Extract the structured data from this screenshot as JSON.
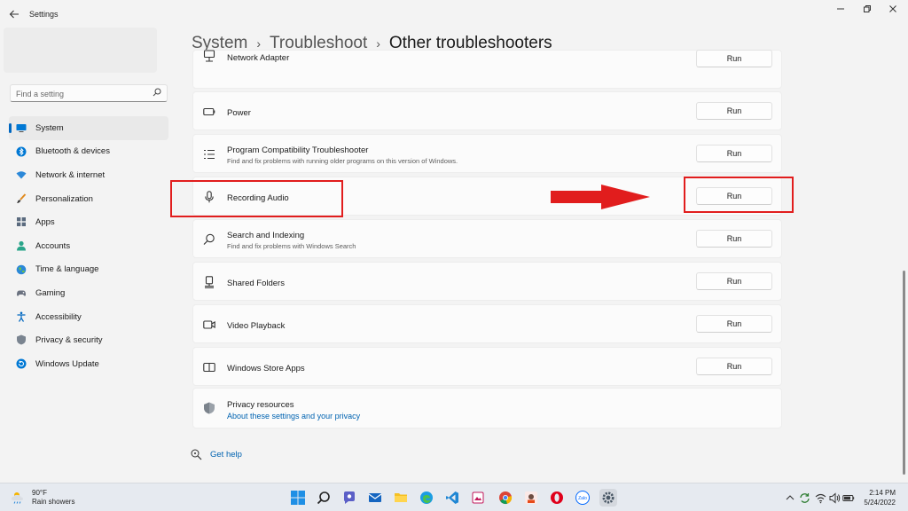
{
  "window": {
    "app_title": "Settings"
  },
  "sidebar": {
    "search_placeholder": "Find a setting",
    "items": [
      {
        "label": "System",
        "icon": "system-icon"
      },
      {
        "label": "Bluetooth & devices",
        "icon": "bluetooth-icon"
      },
      {
        "label": "Network & internet",
        "icon": "wifi-icon"
      },
      {
        "label": "Personalization",
        "icon": "brush-icon"
      },
      {
        "label": "Apps",
        "icon": "apps-icon"
      },
      {
        "label": "Accounts",
        "icon": "account-icon"
      },
      {
        "label": "Time & language",
        "icon": "globe-icon"
      },
      {
        "label": "Gaming",
        "icon": "gamepad-icon"
      },
      {
        "label": "Accessibility",
        "icon": "accessibility-icon"
      },
      {
        "label": "Privacy & security",
        "icon": "shield-icon"
      },
      {
        "label": "Windows Update",
        "icon": "update-icon"
      }
    ]
  },
  "breadcrumb": {
    "items": [
      "System",
      "Troubleshoot"
    ],
    "current": "Other troubleshooters"
  },
  "troubleshooters": [
    {
      "title": "Network Adapter",
      "desc": "",
      "button": "Run",
      "icon": "network-adapter-icon"
    },
    {
      "title": "Power",
      "desc": "",
      "button": "Run",
      "icon": "battery-icon"
    },
    {
      "title": "Program Compatibility Troubleshooter",
      "desc": "Find and fix problems with running older programs on this version of Windows.",
      "button": "Run",
      "icon": "list-icon"
    },
    {
      "title": "Recording Audio",
      "desc": "",
      "button": "Run",
      "icon": "microphone-icon"
    },
    {
      "title": "Search and Indexing",
      "desc": "Find and fix problems with Windows Search",
      "button": "Run",
      "icon": "search-icon"
    },
    {
      "title": "Shared Folders",
      "desc": "",
      "button": "Run",
      "icon": "shared-folder-icon"
    },
    {
      "title": "Video Playback",
      "desc": "",
      "button": "Run",
      "icon": "video-camera-icon"
    },
    {
      "title": "Windows Store Apps",
      "desc": "",
      "button": "Run",
      "icon": "store-app-icon"
    }
  ],
  "privacy": {
    "title": "Privacy resources",
    "link": "About these settings and your privacy"
  },
  "help": {
    "label": "Get help"
  },
  "annotations": {
    "color": "#e11d1d"
  },
  "taskbar": {
    "weather_temp": "90°F",
    "weather_desc": "Rain showers",
    "time": "2:14 PM",
    "date": "5/24/2022",
    "zalo_label": "Zalo"
  },
  "colors": {
    "accent": "#0067c0",
    "link": "#0063b1",
    "annotation": "#e11d1d"
  }
}
